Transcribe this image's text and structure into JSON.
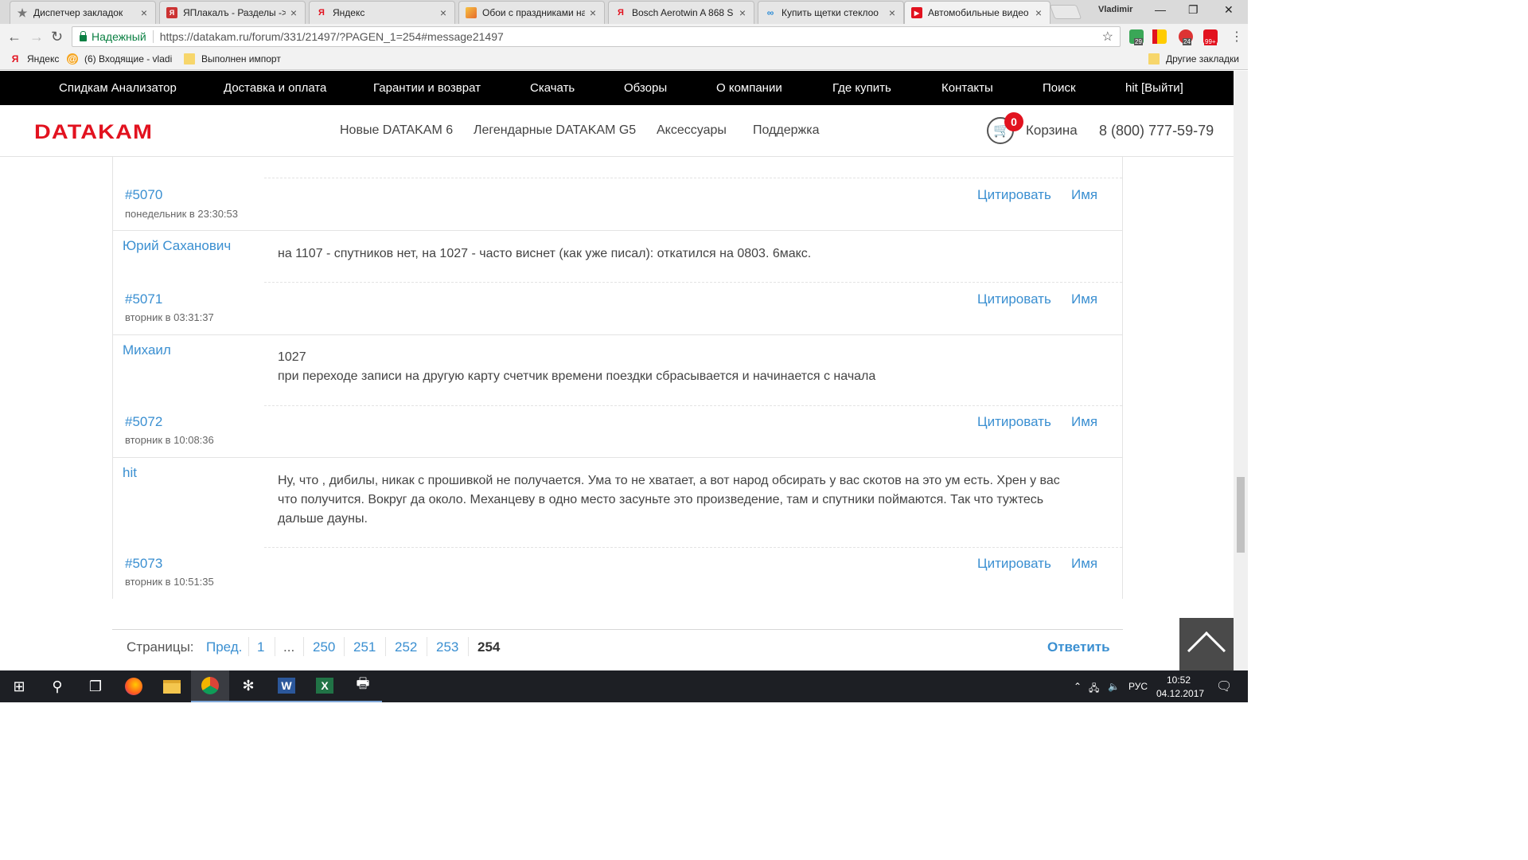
{
  "browser": {
    "tabs": [
      {
        "title": "Диспетчер закладок",
        "icon": "star-icon",
        "active": false
      },
      {
        "title": "ЯПлакалъ - Разделы ->",
        "icon": "yaplakal-icon",
        "active": false
      },
      {
        "title": "Яндекс",
        "icon": "yandex-icon",
        "active": false
      },
      {
        "title": "Обои с праздниками на",
        "icon": "wallpaper-icon",
        "active": false
      },
      {
        "title": "Bosch Aerotwin A 868 S",
        "icon": "yandex-icon",
        "active": false
      },
      {
        "title": "Купить щетки стеклоо",
        "icon": "shop-icon",
        "active": false
      },
      {
        "title": "Автомобильные видео",
        "icon": "youtube-icon",
        "active": true
      }
    ],
    "user": "Vladimir",
    "secure_label": "Надежный",
    "url": "https://datakam.ru/forum/331/21497/?PAGEN_1=254#message21497",
    "ext_badges": {
      "first": "29",
      "second": "24",
      "third": "99+"
    },
    "bookmarks": [
      {
        "label": "Яндекс",
        "icon": "yandex-icon"
      },
      {
        "label": "(6) Входящие - vladi",
        "icon": "mail-icon"
      },
      {
        "label": "Выполнен импорт",
        "icon": "folder-icon"
      }
    ],
    "other_bookmarks": "Другие закладки"
  },
  "site": {
    "top_nav": [
      "Спидкам Анализатор",
      "Доставка и оплата",
      "Гарантии и возврат",
      "Скачать",
      "Обзоры",
      "О компании",
      "Где купить",
      "Контакты",
      "Поиск",
      "hit [Выйти]"
    ],
    "logo": "DATAKAM",
    "main_nav": [
      "Новые DATAKAM 6",
      "Легендарные DATAKAM G5",
      "Аксессуары",
      "Поддержка"
    ],
    "cart_count": "0",
    "cart_label": "Корзина",
    "phone": "8 (800) 777-59-79",
    "brand_color": "#e2121f",
    "link_color": "#3a8fd1"
  },
  "forum": {
    "first_footer": {
      "number": "#5070",
      "date": "понедельник в 23:30:53"
    },
    "posts": [
      {
        "author": "Юрий Саханович",
        "lines": [
          "на 1107 - спутников нет, на 1027 - часто виснет (как уже писал): откатился на 0803. 6макс."
        ],
        "number": "#5071",
        "date": "вторник в 03:31:37"
      },
      {
        "author": "Михаил",
        "lines": [
          "1027",
          "при переходе записи на другую карту счетчик времени поездки сбрасывается и начинается с начала"
        ],
        "number": "#5072",
        "date": "вторник в 10:08:36"
      },
      {
        "author": "hit",
        "lines": [
          "Ну, что , дибилы, никак с прошивкой не получается. Ума то не хватает, а вот народ обсирать у вас скотов на это ум есть. Хрен у вас",
          "что получится. Вокруг да около. Механцеву в одно место засуньте это произведение, там и спутники поймаются. Так что тужтесь",
          "дальше дауны."
        ],
        "number": "#5073",
        "date": "вторник в 10:51:35"
      }
    ],
    "quote_label": "Цитировать",
    "name_label": "Имя",
    "pager": {
      "label": "Страницы:",
      "prev": "Пред.",
      "pages": [
        "1",
        "...",
        "250",
        "251",
        "252",
        "253"
      ],
      "current": "254",
      "reply": "Ответить"
    }
  },
  "taskbar": {
    "lang": "РУС",
    "time": "10:52",
    "date": "04.12.2017"
  }
}
